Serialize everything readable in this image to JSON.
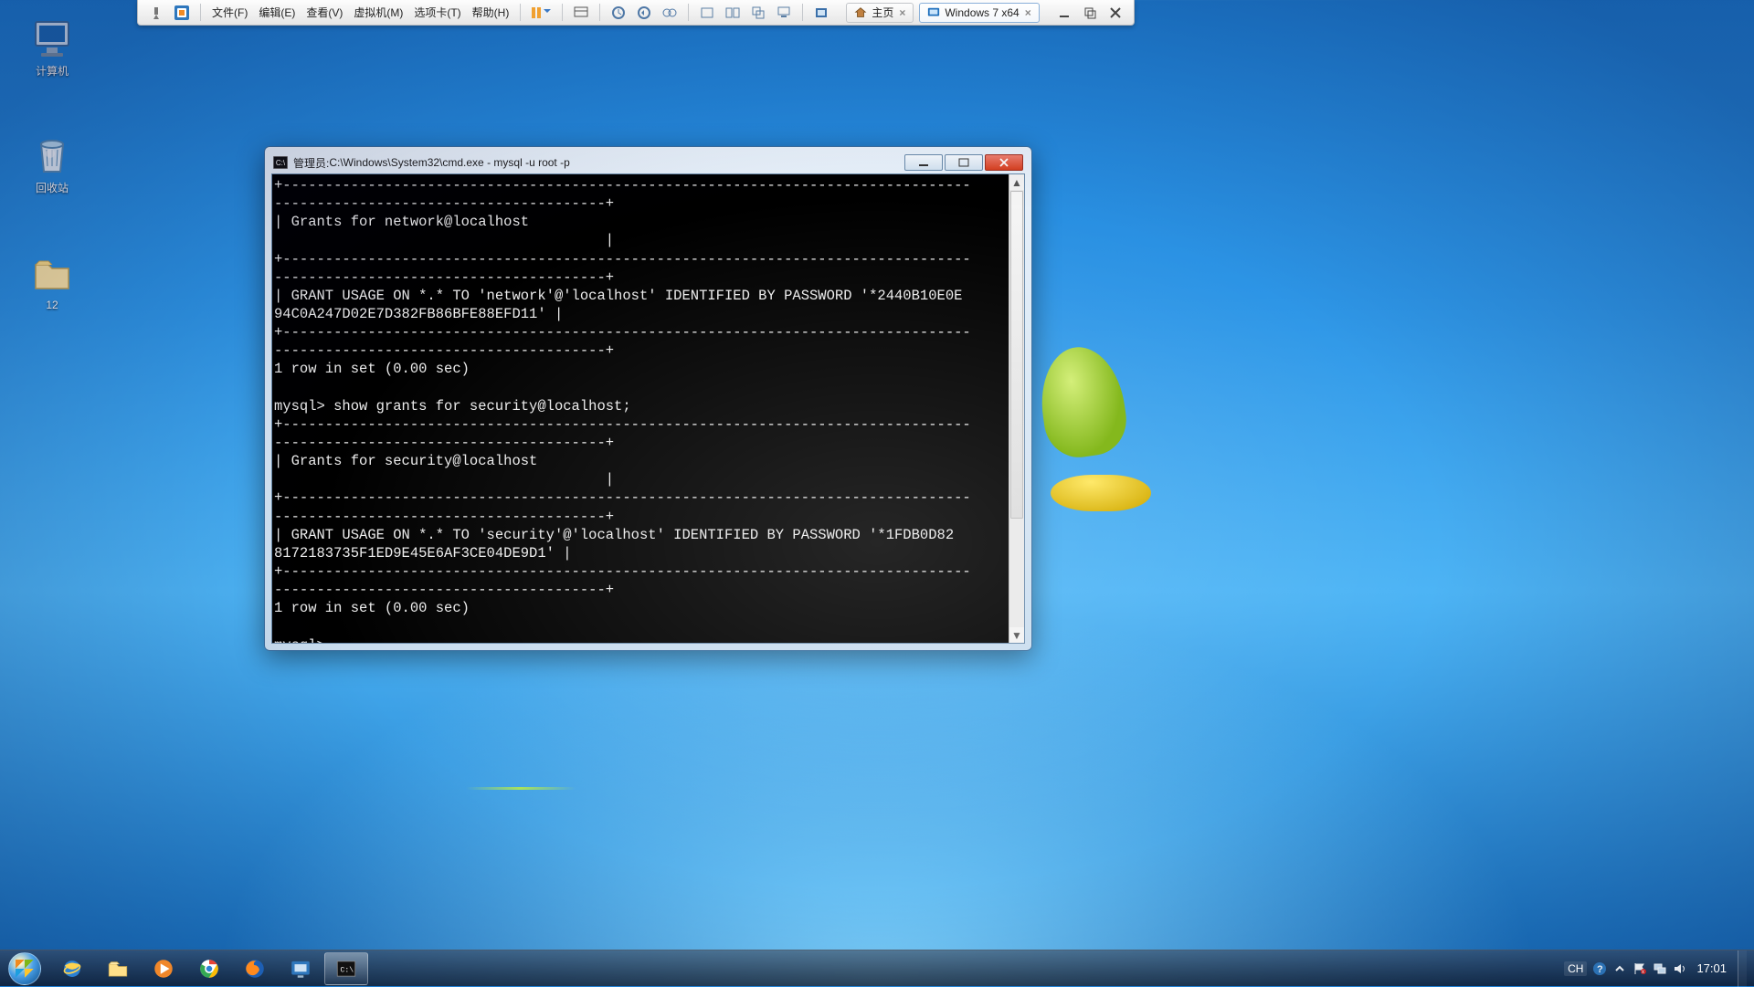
{
  "vmbar": {
    "menu": [
      "文件(F)",
      "编辑(E)",
      "查看(V)",
      "虚拟机(M)",
      "选项卡(T)",
      "帮助(H)"
    ],
    "tabs": [
      {
        "label": "主页",
        "active": false
      },
      {
        "label": "Windows 7 x64",
        "active": true
      }
    ]
  },
  "desktop": {
    "icons": [
      {
        "name": "computer",
        "label": "计算机"
      },
      {
        "name": "recyclebin",
        "label": "回收站"
      },
      {
        "name": "folder12",
        "label": "12"
      }
    ]
  },
  "cmd": {
    "title_prefix": "管理员: ",
    "title_path": "C:\\Windows\\System32\\cmd.exe - mysql  -u root -p",
    "icon_text": "C:\\",
    "content": "+---------------------------------------------------------------------------------\n---------------------------------------+\n| Grants for network@localhost\n                                       |\n+---------------------------------------------------------------------------------\n---------------------------------------+\n| GRANT USAGE ON *.* TO 'network'@'localhost' IDENTIFIED BY PASSWORD '*2440B10E0E\n94C0A247D02E7D382FB86BFE88EFD11' |\n+---------------------------------------------------------------------------------\n---------------------------------------+\n1 row in set (0.00 sec)\n\nmysql> show grants for security@localhost;\n+---------------------------------------------------------------------------------\n---------------------------------------+\n| Grants for security@localhost\n                                       |\n+---------------------------------------------------------------------------------\n---------------------------------------+\n| GRANT USAGE ON *.* TO 'security'@'localhost' IDENTIFIED BY PASSWORD '*1FDB0D82\n8172183735F1ED9E45E6AF3CE04DE9D1' |\n+---------------------------------------------------------------------------------\n---------------------------------------+\n1 row in set (0.00 sec)\n\nmysql> "
  },
  "taskbar": {
    "pinned": [
      {
        "name": "ie"
      },
      {
        "name": "explorer"
      },
      {
        "name": "mediaplayer"
      },
      {
        "name": "chrome"
      },
      {
        "name": "firefox"
      },
      {
        "name": "vmware"
      },
      {
        "name": "cmd",
        "active": true
      }
    ],
    "lang": "CH",
    "clock": "17:01"
  }
}
